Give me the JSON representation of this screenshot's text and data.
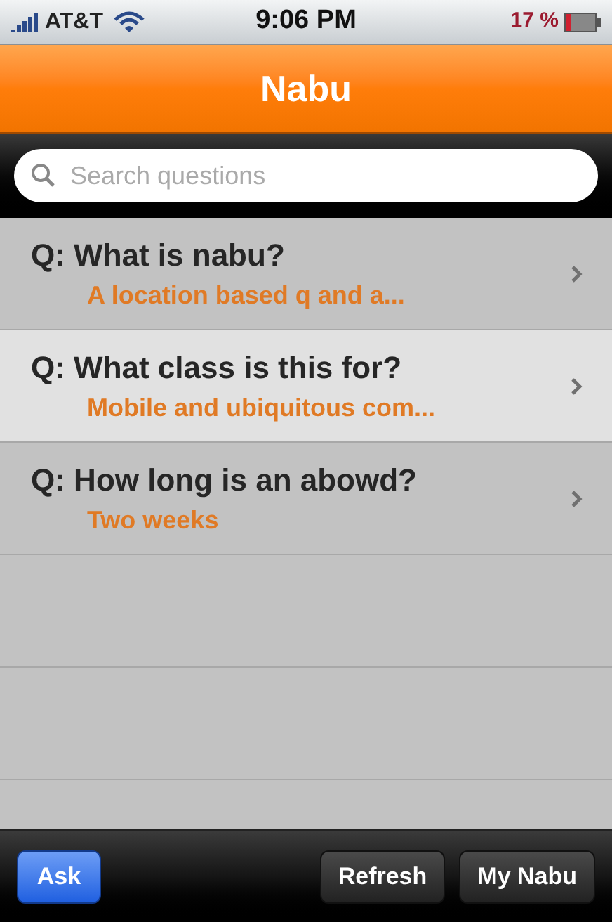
{
  "status_bar": {
    "carrier": "AT&T",
    "time": "9:06 PM",
    "battery": "17 %"
  },
  "nav_bar": {
    "title": "Nabu"
  },
  "search": {
    "placeholder": "Search questions"
  },
  "questions": [
    {
      "question": "Q: What is nabu?",
      "answer": "A location based q and a...",
      "selected": false
    },
    {
      "question": "Q: What class is this for?",
      "answer": "Mobile and ubiquitous com...",
      "selected": true
    },
    {
      "question": "Q: How long is an abowd?",
      "answer": "Two weeks",
      "selected": false
    }
  ],
  "toolbar": [
    {
      "label": "Ask",
      "kind": "primary"
    },
    {
      "label": "Refresh",
      "kind": "plain"
    },
    {
      "label": "My Nabu",
      "kind": "plain"
    }
  ]
}
